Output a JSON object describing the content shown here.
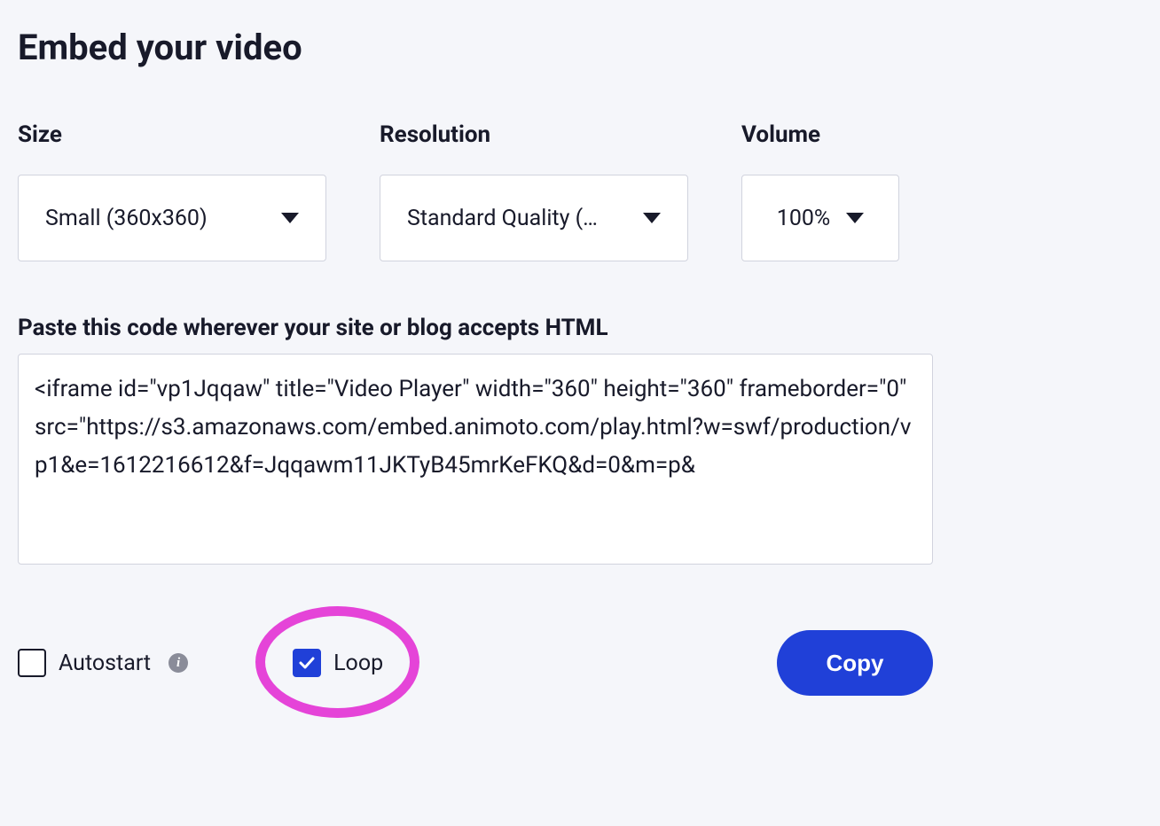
{
  "title": "Embed your video",
  "fields": {
    "size": {
      "label": "Size",
      "value": "Small (360x360)"
    },
    "resolution": {
      "label": "Resolution",
      "value": "Standard Quality (…"
    },
    "volume": {
      "label": "Volume",
      "value": "100%"
    }
  },
  "code": {
    "label": "Paste this code wherever your site or blog accepts HTML",
    "value": "<iframe id=\"vp1Jqqaw\" title=\"Video Player\" width=\"360\" height=\"360\" frameborder=\"0\" src=\"https://s3.amazonaws.com/embed.animoto.com/play.html?w=swf/production/vp1&e=1612216612&f=Jqqawm11JKTyB45mrKeFKQ&d=0&m=p&"
  },
  "options": {
    "autostart": {
      "label": "Autostart",
      "checked": false
    },
    "loop": {
      "label": "Loop",
      "checked": true
    }
  },
  "copy": {
    "label": "Copy"
  },
  "annotation": {
    "highlight": "loop"
  }
}
